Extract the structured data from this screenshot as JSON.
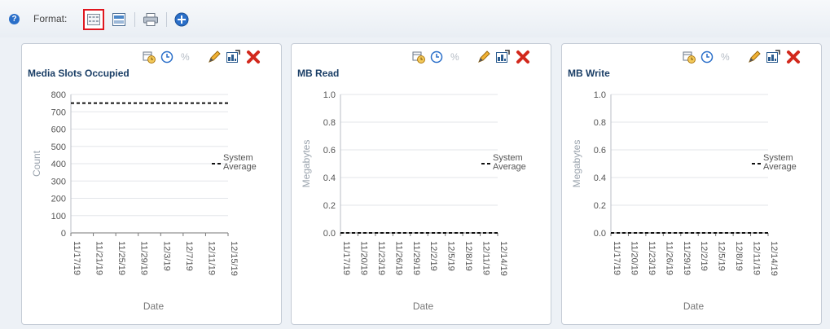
{
  "toolbar": {
    "help_icon": "question-icon",
    "format_label": "Format:",
    "buttons": [
      "grid-layout-icon",
      "single-layout-icon",
      "print-icon",
      "add-icon"
    ]
  },
  "colors": {
    "title": "#1a3e66",
    "accent": "#2a6fc9",
    "close": "#d2281c",
    "selection": "#e0171f"
  },
  "panels": [
    {
      "title": "Media Slots Occupied",
      "tools": [
        "calendar-clock-icon",
        "clock-icon",
        "percent-icon",
        "edit-icon",
        "export-icon",
        "close-icon"
      ],
      "chart_data": {
        "type": "line",
        "title": "Media Slots Occupied",
        "xlabel": "Date",
        "ylabel": "Count",
        "ylim": [
          0,
          800
        ],
        "yticks": [
          "800",
          "700",
          "600",
          "500",
          "400",
          "300",
          "200",
          "100",
          "0"
        ],
        "xticks": [
          "11/17/19",
          "11/21/19",
          "11/25/19",
          "11/29/19",
          "12/3/19",
          "12/7/19",
          "12/11/19",
          "12/15/19"
        ],
        "series": [
          {
            "name": "System Average",
            "style": "dashed",
            "values": [
              750,
              750,
              750,
              750,
              750,
              750,
              750,
              750
            ]
          }
        ],
        "legend": [
          "System",
          "Average"
        ],
        "legend_position": "right",
        "grid": true
      }
    },
    {
      "title": "MB Read",
      "tools": [
        "calendar-clock-icon",
        "clock-icon",
        "percent-icon",
        "edit-icon",
        "export-icon",
        "close-icon"
      ],
      "chart_data": {
        "type": "line",
        "title": "MB Read",
        "xlabel": "Date",
        "ylabel": "Megabytes",
        "ylim": [
          0,
          1
        ],
        "yticks": [
          "1.0",
          "0.8",
          "0.6",
          "0.4",
          "0.2",
          "0.0"
        ],
        "xticks": [
          "11/17/19",
          "11/20/19",
          "11/23/19",
          "11/26/19",
          "11/29/19",
          "12/2/19",
          "12/5/19",
          "12/8/19",
          "12/11/19",
          "12/14/19"
        ],
        "series": [
          {
            "name": "System Average",
            "style": "dashed",
            "values": [
              0,
              0,
              0,
              0,
              0,
              0,
              0,
              0,
              0,
              0
            ]
          }
        ],
        "legend": [
          "System",
          "Average"
        ],
        "legend_position": "right",
        "grid": true
      }
    },
    {
      "title": "MB Write",
      "tools": [
        "calendar-clock-icon",
        "clock-icon",
        "percent-icon",
        "edit-icon",
        "export-icon",
        "close-icon"
      ],
      "chart_data": {
        "type": "line",
        "title": "MB Write",
        "xlabel": "Date",
        "ylabel": "Megabytes",
        "ylim": [
          0,
          1
        ],
        "yticks": [
          "1.0",
          "0.8",
          "0.6",
          "0.4",
          "0.2",
          "0.0"
        ],
        "xticks": [
          "11/17/19",
          "11/20/19",
          "11/23/19",
          "11/26/19",
          "11/29/19",
          "12/2/19",
          "12/5/19",
          "12/8/19",
          "12/11/19",
          "12/14/19"
        ],
        "series": [
          {
            "name": "System Average",
            "style": "dashed",
            "values": [
              0,
              0,
              0,
              0,
              0,
              0,
              0,
              0,
              0,
              0
            ]
          }
        ],
        "legend": [
          "System",
          "Average"
        ],
        "legend_position": "right",
        "grid": true
      }
    }
  ]
}
